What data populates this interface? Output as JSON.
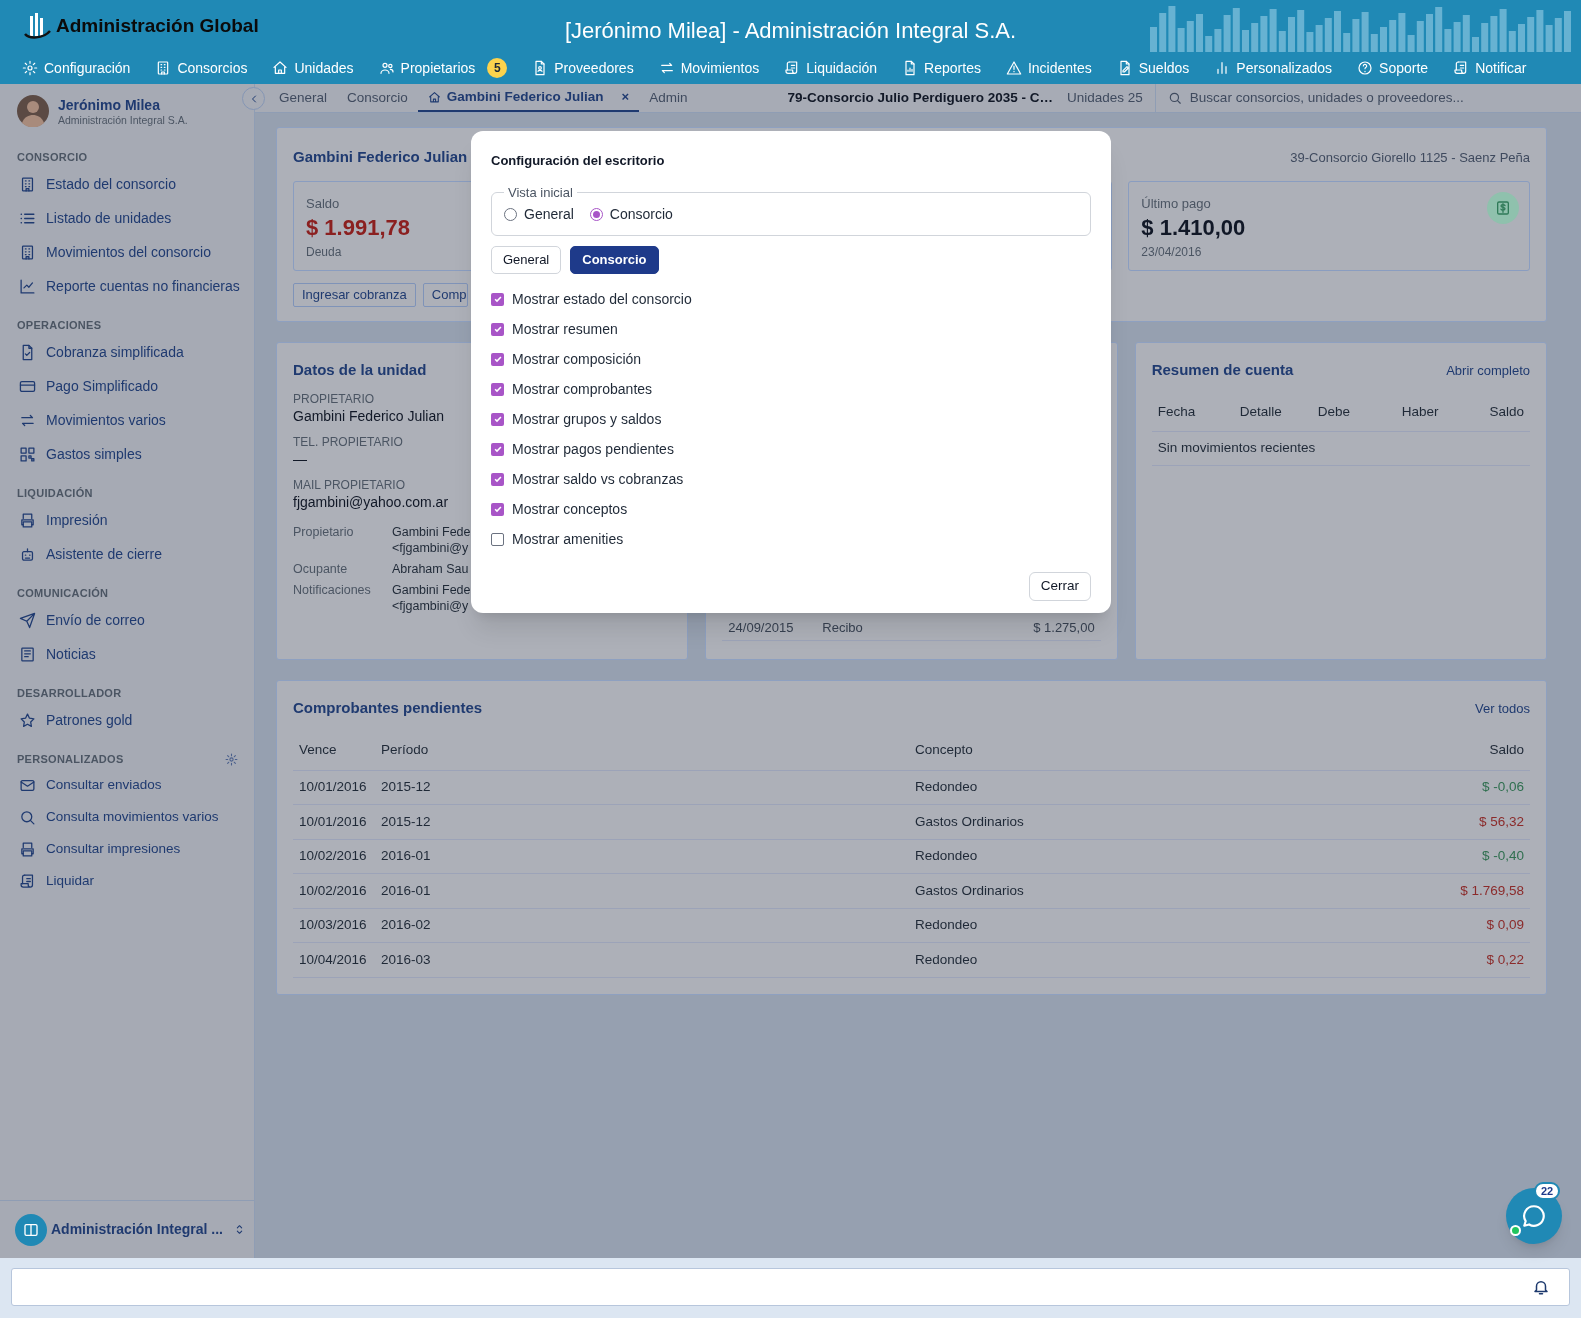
{
  "app": {
    "logo_text": "Administración Global",
    "title": "[Jerónimo Milea] - Administración Integral S.A."
  },
  "nav": [
    {
      "label": "Configuración"
    },
    {
      "label": "Consorcios"
    },
    {
      "label": "Unidades"
    },
    {
      "label": "Propietarios",
      "badge": "5"
    },
    {
      "label": "Proveedores"
    },
    {
      "label": "Movimientos"
    },
    {
      "label": "Liquidación"
    },
    {
      "label": "Reportes"
    },
    {
      "label": "Incidentes"
    },
    {
      "label": "Sueldos"
    },
    {
      "label": "Personalizados"
    },
    {
      "label": "Soporte"
    },
    {
      "label": "Notificar"
    }
  ],
  "user": {
    "name": "Jerónimo Milea",
    "company": "Administración Integral S.A."
  },
  "sidebar": {
    "sections": [
      {
        "title": "CONSORCIO",
        "items": [
          "Estado del consorcio",
          "Listado de unidades",
          "Movimientos del consorcio",
          "Reporte cuentas no financieras"
        ]
      },
      {
        "title": "OPERACIONES",
        "items": [
          "Cobranza simplificada",
          "Pago Simplificado",
          "Movimientos varios",
          "Gastos simples"
        ]
      },
      {
        "title": "LIQUIDACIÓN",
        "items": [
          "Impresión",
          "Asistente de cierre"
        ]
      },
      {
        "title": "COMUNICACIÓN",
        "items": [
          "Envío de correo",
          "Noticias"
        ]
      },
      {
        "title": "DESARROLLADOR",
        "items": [
          "Patrones gold"
        ]
      },
      {
        "title": "PERSONALIZADOS",
        "settings": true,
        "items": [
          "Consultar enviados",
          "Consulta movimientos varios",
          "Consultar impresiones",
          "Liquidar"
        ]
      }
    ],
    "footer": "Administración Integral ..."
  },
  "tabs": [
    {
      "label": "General",
      "selected": false
    },
    {
      "label": "Consorcio",
      "selected": false
    },
    {
      "label": "Gambini Federico Julian",
      "selected": true,
      "close": "×"
    },
    {
      "label": "Admin",
      "selected": false
    }
  ],
  "context": {
    "consorcio": "79-Consorcio Julio Perdiguero 2035 - C…",
    "units": "Unidades 25",
    "search_placeholder": "Buscar consorcios, unidades o proveedores..."
  },
  "summary": {
    "title": "Gambini Federico Julian",
    "consorcio": "39-Consorcio Giorello 1125 - Saenz Peña",
    "stats": [
      {
        "label": "Saldo",
        "value": "$ 1.991,78",
        "note": "Deuda",
        "kind": "debt"
      },
      {
        "kind": "hidden"
      },
      {
        "label": "Último pago",
        "value": "$ 1.410,00",
        "note": "23/04/2016",
        "kind": "payment"
      }
    ],
    "buttons": [
      "Ingresar cobranza",
      "Comp"
    ]
  },
  "unit": {
    "title": "Datos de la unidad",
    "fields": [
      {
        "label": "PROPIETARIO",
        "value": "Gambini Federico Julian"
      },
      {
        "label": "TEL. PROPIETARIO",
        "value": "—"
      },
      {
        "label": "MAIL PROPIETARIO",
        "value": "fjgambini@yahoo.com.ar"
      }
    ],
    "contacts": [
      {
        "label": "Propietario",
        "lines": [
          "Gambini Fede",
          "<fjgambini@y"
        ]
      },
      {
        "label": "Ocupante",
        "lines": [
          "Abraham Sau"
        ]
      },
      {
        "label": "Notificaciones",
        "lines": [
          "Gambini Fede",
          "<fjgambini@y"
        ]
      }
    ]
  },
  "movements": {
    "rows": [
      [
        "24/09/2015",
        "Recibo",
        "$ 1.275,00"
      ]
    ]
  },
  "account": {
    "title": "Resumen de cuenta",
    "link": "Abrir completo",
    "columns": [
      "Fecha",
      "Detalle",
      "Debe",
      "Haber",
      "Saldo"
    ],
    "empty": "Sin movimientos recientes"
  },
  "pending": {
    "title": "Comprobantes pendientes",
    "link": "Ver todos",
    "columns": [
      "Vence",
      "Período",
      "Concepto",
      "Saldo"
    ],
    "rows": [
      {
        "due": "10/01/2016",
        "period": "2015-12",
        "concept": "Redondeo",
        "balance": "$ -0,06",
        "color": "#2f6f4f"
      },
      {
        "due": "10/01/2016",
        "period": "2015-12",
        "concept": "Gastos Ordinarios",
        "balance": "$ 56,32",
        "color": "#8b2b2b"
      },
      {
        "due": "10/02/2016",
        "period": "2016-01",
        "concept": "Redondeo",
        "balance": "$ -0,40",
        "color": "#2f6f4f"
      },
      {
        "due": "10/02/2016",
        "period": "2016-01",
        "concept": "Gastos Ordinarios",
        "balance": "$ 1.769,58",
        "color": "#8b2b2b"
      },
      {
        "due": "10/03/2016",
        "period": "2016-02",
        "concept": "Redondeo",
        "balance": "$ 0,09",
        "color": "#8b2b2b"
      },
      {
        "due": "10/04/2016",
        "period": "2016-03",
        "concept": "Redondeo",
        "balance": "$ 0,22",
        "color": "#8b2b2b"
      }
    ]
  },
  "dialog": {
    "title": "Configuración del escritorio",
    "legend": "Vista inicial",
    "radios": [
      {
        "label": "General",
        "selected": false
      },
      {
        "label": "Consorcio",
        "selected": true
      }
    ],
    "toggles": [
      {
        "label": "General",
        "selected": false
      },
      {
        "label": "Consorcio",
        "selected": true
      }
    ],
    "options": [
      {
        "label": "Mostrar estado del consorcio",
        "checked": true
      },
      {
        "label": "Mostrar resumen",
        "checked": true
      },
      {
        "label": "Mostrar composición",
        "checked": true
      },
      {
        "label": "Mostrar comprobantes",
        "checked": true
      },
      {
        "label": "Mostrar grupos y saldos",
        "checked": true
      },
      {
        "label": "Mostrar pagos pendientes",
        "checked": true
      },
      {
        "label": "Mostrar saldo vs cobranzas",
        "checked": true
      },
      {
        "label": "Mostrar conceptos",
        "checked": true
      },
      {
        "label": "Mostrar amenities",
        "checked": false
      }
    ],
    "close": "Cerrar"
  },
  "chat": {
    "badge": "22",
    "online": true
  }
}
